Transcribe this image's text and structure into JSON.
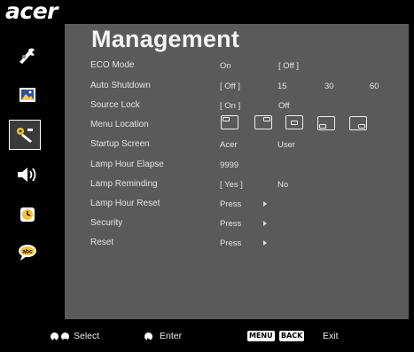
{
  "brand": "acer",
  "title": "Management",
  "sidebar": {
    "items": [
      {
        "icon": "image-settings-icon"
      },
      {
        "icon": "picture-icon"
      },
      {
        "icon": "management-icon",
        "active": true
      },
      {
        "icon": "speaker-icon"
      },
      {
        "icon": "timer-icon"
      },
      {
        "icon": "language-icon",
        "text": "abc"
      }
    ]
  },
  "menu": {
    "eco_mode": {
      "label": "ECO Mode",
      "options": [
        "On",
        "[ Off ]"
      ]
    },
    "auto_shutdown": {
      "label": "Auto Shutdown",
      "options": [
        "[ Off ]",
        "15",
        "30",
        "60"
      ]
    },
    "source_lock": {
      "label": "Source Lock",
      "options": [
        "[ On ]",
        "Off"
      ]
    },
    "menu_location": {
      "label": "Menu Location"
    },
    "startup_screen": {
      "label": "Startup Screen",
      "options": [
        "Acer",
        "User"
      ]
    },
    "lamp_hour_elapse": {
      "label": "Lamp Hour Elapse",
      "value": "9999"
    },
    "lamp_reminding": {
      "label": "Lamp Reminding",
      "options": [
        "[ Yes ]",
        "No"
      ]
    },
    "lamp_hour_reset": {
      "label": "Lamp Hour Reset",
      "action": "Press"
    },
    "security": {
      "label": "Security",
      "action": "Press"
    },
    "reset": {
      "label": "Reset",
      "action": "Press"
    }
  },
  "footer": {
    "select": "Select",
    "enter": "Enter",
    "menu_key": "MENU",
    "back_key": "BACK",
    "exit": "Exit"
  }
}
